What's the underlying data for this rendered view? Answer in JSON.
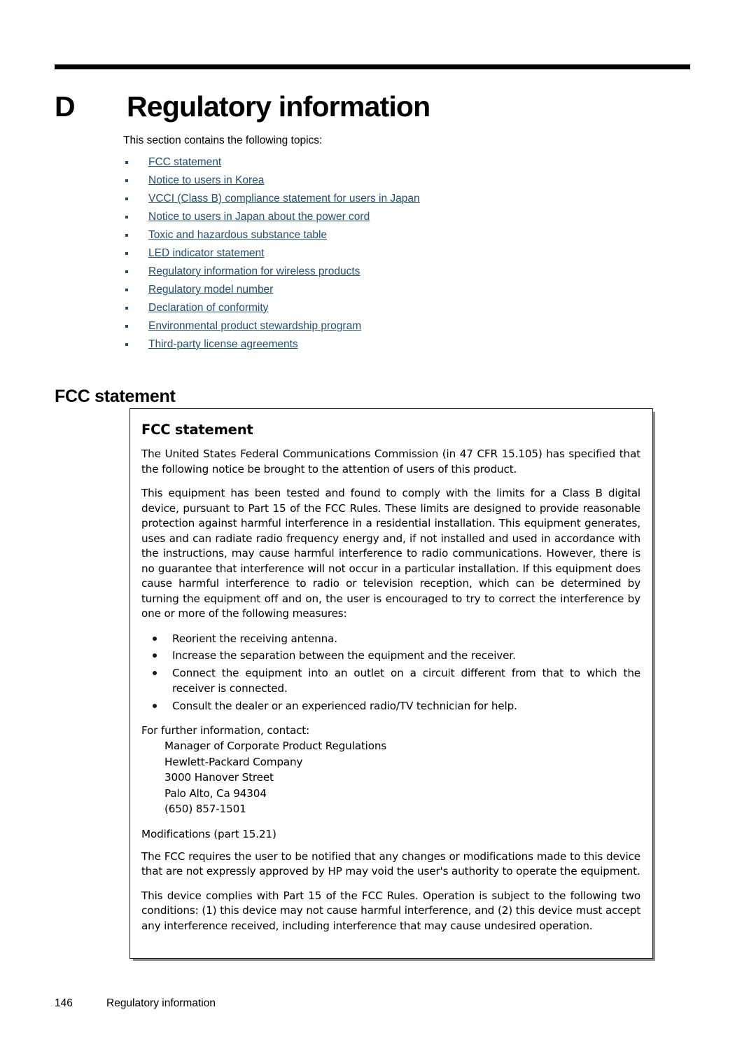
{
  "chapter": {
    "letter": "D",
    "title": "Regulatory information"
  },
  "intro": {
    "lead": "This section contains the following topics:",
    "topics": [
      "FCC statement",
      "Notice to users in Korea",
      "VCCI (Class B) compliance statement for users in Japan",
      "Notice to users in Japan about the power cord",
      "Toxic and hazardous substance table",
      "LED indicator statement",
      "Regulatory information for wireless products",
      "Regulatory model number",
      "Declaration of conformity",
      "Environmental product stewardship program",
      "Third-party license agreements"
    ]
  },
  "section": {
    "heading": "FCC statement"
  },
  "notice": {
    "title": "FCC statement",
    "paragraph_1": "The United States Federal Communications Commission (in 47 CFR 15.105) has specified that the following notice be brought to the attention of users of this product.",
    "paragraph_2": "This equipment has been tested and found to comply with the limits for a Class B digital device, pursuant to Part 15 of the FCC Rules.  These limits are designed to provide reasonable protection against harmful interference in a residential installation.  This equipment generates, uses and can radiate radio frequency energy and, if not installed and used in accordance with the instructions, may cause harmful interference to radio communications.  However, there is no guarantee that interference will not occur in a particular installation.  If this equipment does cause harmful interference to radio or television reception, which can be determined by turning the equipment off and on, the user is encouraged to try to correct the interference by one or more of the following measures:",
    "measures": [
      "Reorient the receiving antenna.",
      "Increase the separation between the equipment and the receiver.",
      "Connect the equipment into an outlet on a circuit different from that to which the receiver is connected.",
      "Consult the dealer or an experienced radio/TV technician for help."
    ],
    "contact_lead": "For further information, contact:",
    "contact_lines": [
      "Manager of Corporate Product Regulations",
      "Hewlett-Packard Company",
      "3000 Hanover Street",
      "Palo Alto, Ca 94304",
      "(650) 857-1501"
    ],
    "modifications_heading": "Modifications (part 15.21)",
    "paragraph_3": "The FCC requires the user to be notified that any changes or modifications made to this device that are not expressly approved by HP may void the user's authority to operate the equipment.",
    "paragraph_4": "This device complies with Part 15 of the FCC Rules.  Operation is subject to the following two conditions:  (1) this device may not cause harmful interference, and (2) this device must accept any interference received, including interference that may cause undesired operation."
  },
  "footer": {
    "page_number": "146",
    "title": "Regulatory information"
  },
  "colors": {
    "link": "#1f4f7a",
    "text": "#000000",
    "box_border": "#1a1a1a",
    "box_shadow": "#8c8c8c"
  }
}
